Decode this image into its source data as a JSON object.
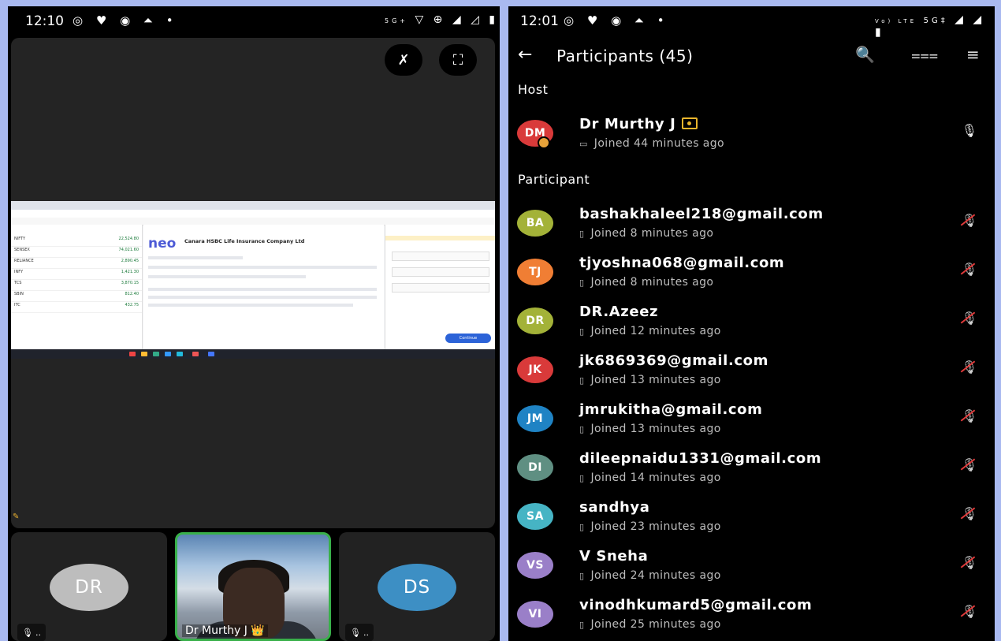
{
  "left_status": {
    "time": "12:10",
    "left_icons": "◎ ♥ ◉ ⏶ •",
    "right_icons": "▽ ⊕ ◢ ◿ ▮",
    "network": "5G+"
  },
  "right_status": {
    "time": "12:01",
    "left_icons": "◎ ♥ ◉ ⏶ •",
    "network": "5G‡",
    "volte": "Vo) LTE",
    "right_icons": "◢ ◢ ▮"
  },
  "meeting": {
    "screen_share": {
      "company_title": "Canara HSBC Life Insurance Company Ltd",
      "logo": "neo",
      "button": "Continue",
      "watchlist": [
        {
          "name": "NIFTY",
          "value": "22,524.80"
        },
        {
          "name": "SENSEX",
          "value": "74,021.60"
        },
        {
          "name": "RELIANCE",
          "value": "2,890.45"
        },
        {
          "name": "INFY",
          "value": "1,421.30"
        },
        {
          "name": "TCS",
          "value": "3,870.15"
        },
        {
          "name": "SBIN",
          "value": "812.40"
        },
        {
          "name": "ITC",
          "value": "432.75"
        }
      ]
    },
    "tiles": [
      {
        "initials": "DR",
        "color": "#bdbdbd",
        "mute_label": ".."
      },
      {
        "name": "Dr Murthy J",
        "crown": "👑"
      },
      {
        "initials": "DS",
        "color": "#3d8fc4",
        "mute_label": ".."
      }
    ]
  },
  "participants_panel": {
    "title": "Participants (45)",
    "colors": {
      "avatar_red": "#d93a3a",
      "avatar_olive": "#a3b238",
      "avatar_orange": "#f07e34",
      "avatar_blue": "#1f83c4",
      "avatar_teal": "#5f8f82",
      "avatar_cyan": "#46b4c4",
      "avatar_purple": "#9a7fc8"
    },
    "host_label": "Host",
    "participant_label": "Participant",
    "host": {
      "initials": "DM",
      "name": "Dr Murthy J",
      "joined": "Joined 44 minutes ago",
      "color": "#d93a3a"
    },
    "participants": [
      {
        "initials": "BA",
        "name": "bashakhaleel218@gmail.com",
        "joined": "Joined 8 minutes ago",
        "color": "#a3b238"
      },
      {
        "initials": "TJ",
        "name": "tjyoshna068@gmail.com",
        "joined": "Joined 8 minutes ago",
        "color": "#f07e34"
      },
      {
        "initials": "DR",
        "name": "DR.Azeez",
        "joined": "Joined 12 minutes ago",
        "color": "#a3b238"
      },
      {
        "initials": "JK",
        "name": "jk6869369@gmail.com",
        "joined": "Joined 13 minutes ago",
        "color": "#d93a3a"
      },
      {
        "initials": "JM",
        "name": "jmrukitha@gmail.com",
        "joined": "Joined 13 minutes ago",
        "color": "#1f83c4"
      },
      {
        "initials": "DI",
        "name": "dileepnaidu1331@gmail.com",
        "joined": "Joined 14 minutes ago",
        "color": "#5f8f82"
      },
      {
        "initials": "SA",
        "name": "sandhya",
        "joined": "Joined 23 minutes ago",
        "color": "#46b4c4"
      },
      {
        "initials": "VS",
        "name": "V Sneha",
        "joined": "Joined 24 minutes ago",
        "color": "#9a7fc8"
      },
      {
        "initials": "VI",
        "name": "vinodhkumard5@gmail.com",
        "joined": "Joined 25 minutes ago",
        "color": "#9a7fc8"
      }
    ]
  }
}
